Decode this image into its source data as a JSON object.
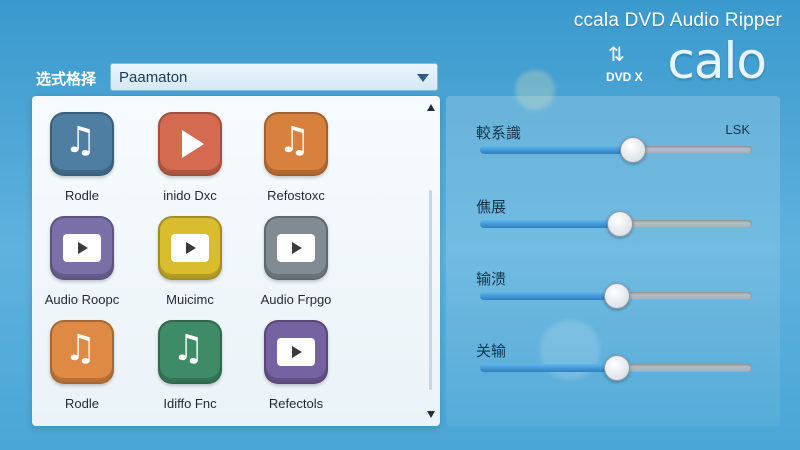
{
  "window": {
    "title": "ccala DVD Audio Ripper",
    "logo_text": "calo",
    "logo_sub": "DVD X"
  },
  "selector": {
    "label": "选式格择",
    "value": "Paamaton"
  },
  "tiles": [
    {
      "label": "Rodle",
      "icon": "music-note-icon",
      "color": "#4e7fa3"
    },
    {
      "label": "inido Dxc",
      "icon": "play-icon",
      "color": "#d46a4f"
    },
    {
      "label": "Refostoxc",
      "icon": "music-note-icon",
      "color": "#d8813f"
    },
    {
      "label": "Audio Roopc",
      "icon": "video-icon",
      "color": "#7b6fa8"
    },
    {
      "label": "Muicimc",
      "icon": "video-icon",
      "color": "#d9bd2f"
    },
    {
      "label": "Audio Frpgo",
      "icon": "video-icon",
      "color": "#818b93"
    },
    {
      "label": "Rodle",
      "icon": "music-note-icon",
      "color": "#de8a44"
    },
    {
      "label": "Idiffo Fnc",
      "icon": "music-note-icon",
      "color": "#3f8b67"
    },
    {
      "label": "Refectols",
      "icon": "video-icon",
      "color": "#7562a0"
    }
  ],
  "sliders": [
    {
      "label": "較系識",
      "value_text": "LSK",
      "level": 0.56
    },
    {
      "label": "僬展",
      "value_text": "",
      "level": 0.51
    },
    {
      "label": "输溃",
      "value_text": "",
      "level": 0.5
    },
    {
      "label": "关输",
      "value_text": "",
      "level": 0.5
    }
  ]
}
